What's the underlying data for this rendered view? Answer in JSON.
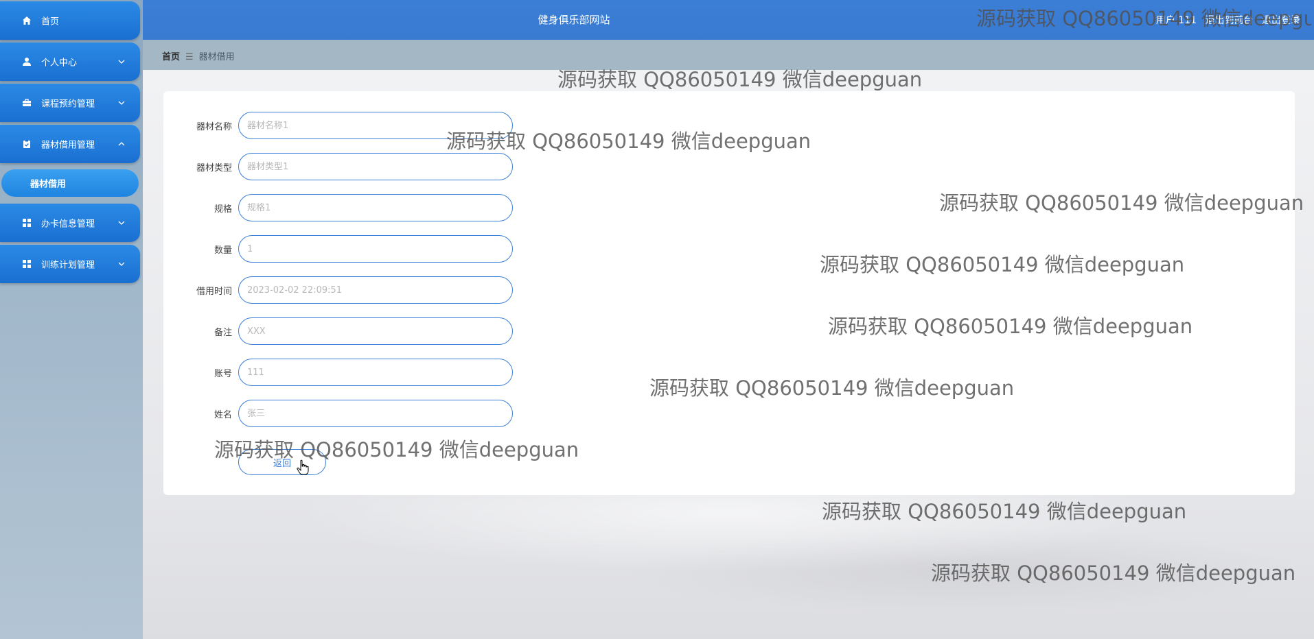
{
  "header": {
    "title": "健身俱乐部网站",
    "user_label": "用户 111",
    "back_to_home": "退出到前台",
    "logout": "退出登录"
  },
  "breadcrumb": {
    "home": "首页",
    "separator": "☰",
    "current": "器材借用"
  },
  "sidebar": {
    "items": [
      {
        "label": "首页",
        "icon": "home-icon"
      },
      {
        "label": "个人中心",
        "icon": "user-icon"
      },
      {
        "label": "课程预约管理",
        "icon": "briefcase-icon"
      },
      {
        "label": "器材借用管理",
        "icon": "clipboard-icon"
      },
      {
        "label": "办卡信息管理",
        "icon": "grid-icon"
      },
      {
        "label": "训练计划管理",
        "icon": "grid-icon"
      }
    ],
    "submenu": {
      "label": "器材借用"
    }
  },
  "form": {
    "fields": [
      {
        "label": "器材名称",
        "placeholder": "器材名称1"
      },
      {
        "label": "器材类型",
        "placeholder": "器材类型1"
      },
      {
        "label": "规格",
        "placeholder": "规格1"
      },
      {
        "label": "数量",
        "placeholder": "1"
      },
      {
        "label": "借用时间",
        "placeholder": "2023-02-02 22:09:51"
      },
      {
        "label": "备注",
        "placeholder": "XXX"
      },
      {
        "label": "账号",
        "placeholder": "111"
      },
      {
        "label": "姓名",
        "placeholder": "张三"
      }
    ],
    "back_button": "返回"
  },
  "watermark": "源码获取 QQ86050149 微信deepguan"
}
